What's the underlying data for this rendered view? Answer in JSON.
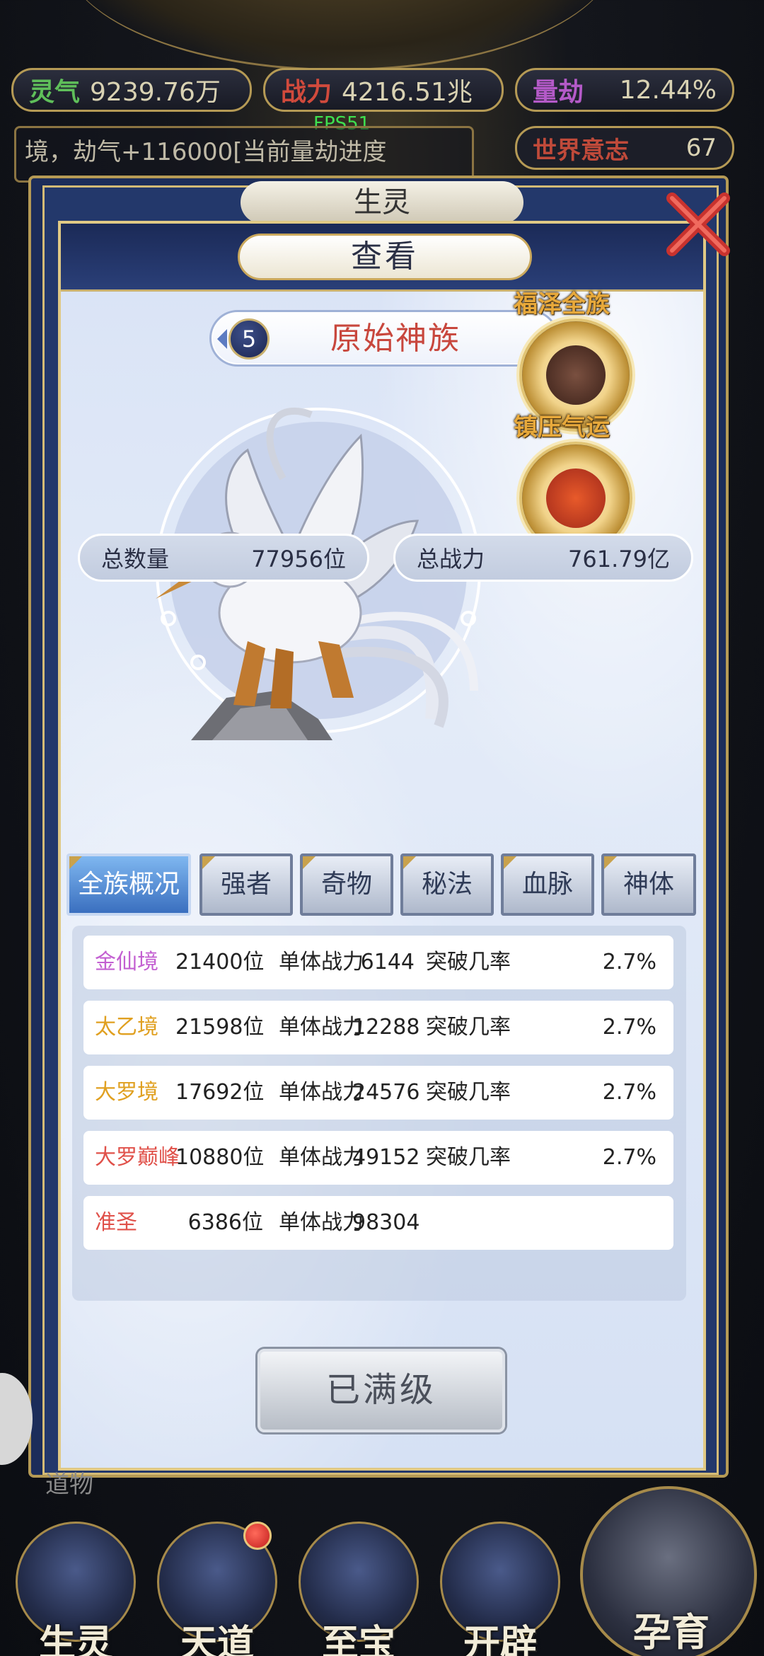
{
  "resources": {
    "lingqi_label": "灵气",
    "lingqi_value": "9239.76万",
    "power_label": "战力",
    "power_value": "4216.51兆",
    "calamity_label": "量劫",
    "calamity_value": "12.44%"
  },
  "fps": "FPS51",
  "background": {
    "log_text": "境，劫气+116000[当前量劫进度",
    "world_label": "世界意志",
    "world_value": "67",
    "tab_behind": "生灵",
    "item_behind": "道物"
  },
  "dialog": {
    "title": "查看",
    "race_level": "5",
    "race_name": "原始神族",
    "badge_1": "福泽全族",
    "badge_2": "镇压气运",
    "total_count_label": "总数量",
    "total_count_value": "77956位",
    "total_power_label": "总战力",
    "total_power_value": "761.79亿",
    "tabs": [
      "全族概况",
      "强者",
      "奇物",
      "秘法",
      "血脉",
      "神体"
    ],
    "realms": [
      {
        "name": "金仙境",
        "color": "#c35fd1",
        "count": "21400位",
        "power_label": "单体战力",
        "power": "6144",
        "break_label": "突破几率",
        "break": "2.7%"
      },
      {
        "name": "太乙境",
        "color": "#e0a020",
        "count": "21598位",
        "power_label": "单体战力",
        "power": "12288",
        "break_label": "突破几率",
        "break": "2.7%"
      },
      {
        "name": "大罗境",
        "color": "#e0a020",
        "count": "17692位",
        "power_label": "单体战力",
        "power": "24576",
        "break_label": "突破几率",
        "break": "2.7%"
      },
      {
        "name": "大罗巅峰",
        "color": "#e0514a",
        "count": "10880位",
        "power_label": "单体战力",
        "power": "49152",
        "break_label": "突破几率",
        "break": "2.7%"
      },
      {
        "name": "准圣",
        "color": "#e0514a",
        "count": "6386位",
        "power_label": "单体战力",
        "power": "98304",
        "break_label": "",
        "break": ""
      }
    ],
    "max_button": "已满级"
  },
  "nav": {
    "items": [
      "生灵",
      "天道",
      "至宝",
      "开辟"
    ],
    "hatch": "孕育"
  }
}
